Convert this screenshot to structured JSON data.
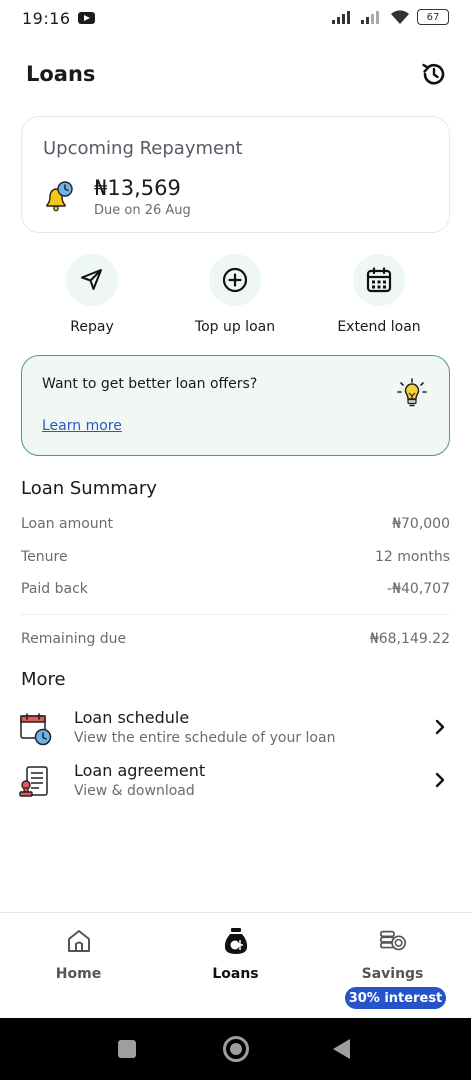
{
  "status_bar": {
    "time": "19:16",
    "battery": "67"
  },
  "header": {
    "title": "Loans"
  },
  "repayment": {
    "title": "Upcoming Repayment",
    "amount": "₦13,569",
    "due": "Due on 26 Aug"
  },
  "actions": [
    {
      "label": "Repay",
      "icon": "send-icon"
    },
    {
      "label": "Top up loan",
      "icon": "plus-circle-icon"
    },
    {
      "label": "Extend loan",
      "icon": "calendar-icon"
    }
  ],
  "promo": {
    "text": "Want to get better loan offers?",
    "link": "Learn more"
  },
  "summary": {
    "title": "Loan Summary",
    "rows": [
      {
        "label": "Loan amount",
        "value": "₦70,000"
      },
      {
        "label": "Tenure",
        "value": "12 months"
      },
      {
        "label": "Paid back",
        "value": "-₦40,707"
      }
    ],
    "remaining": {
      "label": "Remaining due",
      "value": "₦68,149.22"
    }
  },
  "more": {
    "title": "More",
    "items": [
      {
        "title": "Loan schedule",
        "subtitle": "View the entire schedule of your loan",
        "icon": "schedule-icon"
      },
      {
        "title": "Loan agreement",
        "subtitle": "View & download",
        "icon": "agreement-icon"
      }
    ]
  },
  "bottom_nav": {
    "items": [
      {
        "label": "Home",
        "icon": "home-icon"
      },
      {
        "label": "Loans",
        "icon": "loan-bag-icon"
      },
      {
        "label": "Savings",
        "icon": "savings-icon"
      }
    ],
    "active": "Loans",
    "savings_badge": "30% interest"
  },
  "colors": {
    "accent_green": "#4f9d72",
    "promo_bg": "#f1f8f4",
    "link_blue": "#2b56c4",
    "badge_blue": "#2553c9"
  }
}
